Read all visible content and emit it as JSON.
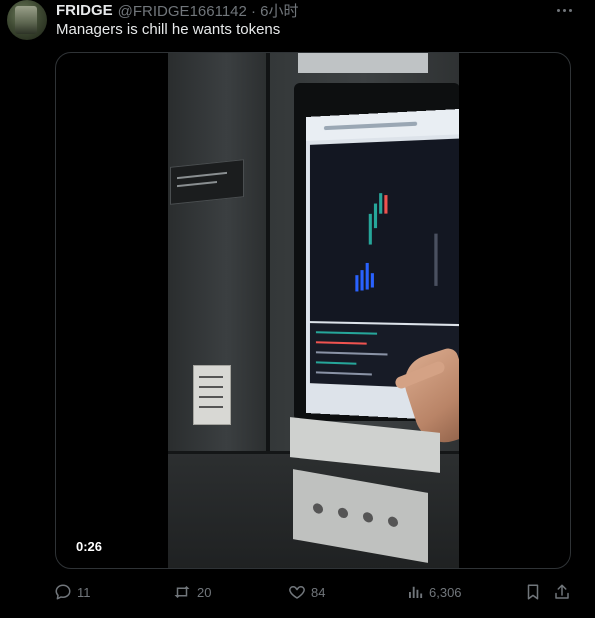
{
  "tweet": {
    "display_name": "FRIDGE",
    "handle_time": "@FRIDGE1661142 · 6小时",
    "text": "Managers is chill he wants tokens",
    "video_time": "0:26"
  },
  "actions": {
    "replies": "11",
    "retweets": "20",
    "likes": "84",
    "views": "6,306"
  },
  "icons": {
    "more": "more-icon",
    "reply": "reply-icon",
    "retweet": "retweet-icon",
    "like": "heart-icon",
    "views": "views-icon",
    "bookmark": "bookmark-icon",
    "share": "share-icon"
  },
  "colors": {
    "background": "#000000",
    "primary_text": "#e7e9ea",
    "secondary_text": "#71767b",
    "border": "#2f3336"
  }
}
